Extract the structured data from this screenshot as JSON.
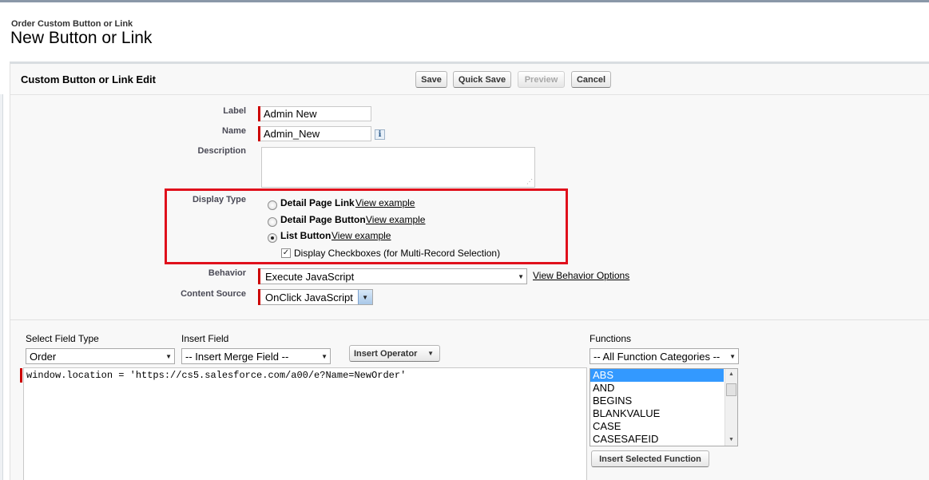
{
  "page": {
    "breadcrumb": "Order Custom Button or Link",
    "title": "New Button or Link"
  },
  "panel": {
    "title": "Custom Button or Link Edit",
    "buttons": {
      "save": "Save",
      "quick_save": "Quick Save",
      "preview": "Preview",
      "cancel": "Cancel"
    }
  },
  "form": {
    "label": {
      "label": "Label",
      "value": "Admin New"
    },
    "name": {
      "label": "Name",
      "value": "Admin_New",
      "info_icon": "info-icon"
    },
    "description": {
      "label": "Description",
      "value": ""
    },
    "display_type": {
      "label": "Display Type",
      "options": [
        {
          "label": "Detail Page Link",
          "link": "View example",
          "checked": false
        },
        {
          "label": "Detail Page Button",
          "link": "View example",
          "checked": false
        },
        {
          "label": "List Button",
          "link": "View example",
          "checked": true
        }
      ],
      "checkbox_label": "Display Checkboxes (for Multi-Record Selection)",
      "checkbox_checked": true
    },
    "behavior": {
      "label": "Behavior",
      "value": "Execute JavaScript",
      "link": "View Behavior Options"
    },
    "content_source": {
      "label": "Content Source",
      "value": "OnClick JavaScript"
    }
  },
  "editor": {
    "select_field_type": {
      "label": "Select Field Type",
      "value": "Order"
    },
    "insert_field": {
      "label": "Insert Field",
      "value": "-- Insert Merge Field --"
    },
    "insert_operator": "Insert Operator",
    "code": "window.location = 'https://cs5.salesforce.com/a00/e?Name=NewOrder'",
    "functions": {
      "label": "Functions",
      "category": "-- All Function Categories --",
      "items": [
        "ABS",
        "AND",
        "BEGINS",
        "BLANKVALUE",
        "CASE",
        "CASESAFEID"
      ],
      "selected": "ABS",
      "insert_button": "Insert Selected Function"
    }
  },
  "colors": {
    "required": "#cc0000",
    "highlight": "#e0101c",
    "selection": "#3399ff"
  }
}
